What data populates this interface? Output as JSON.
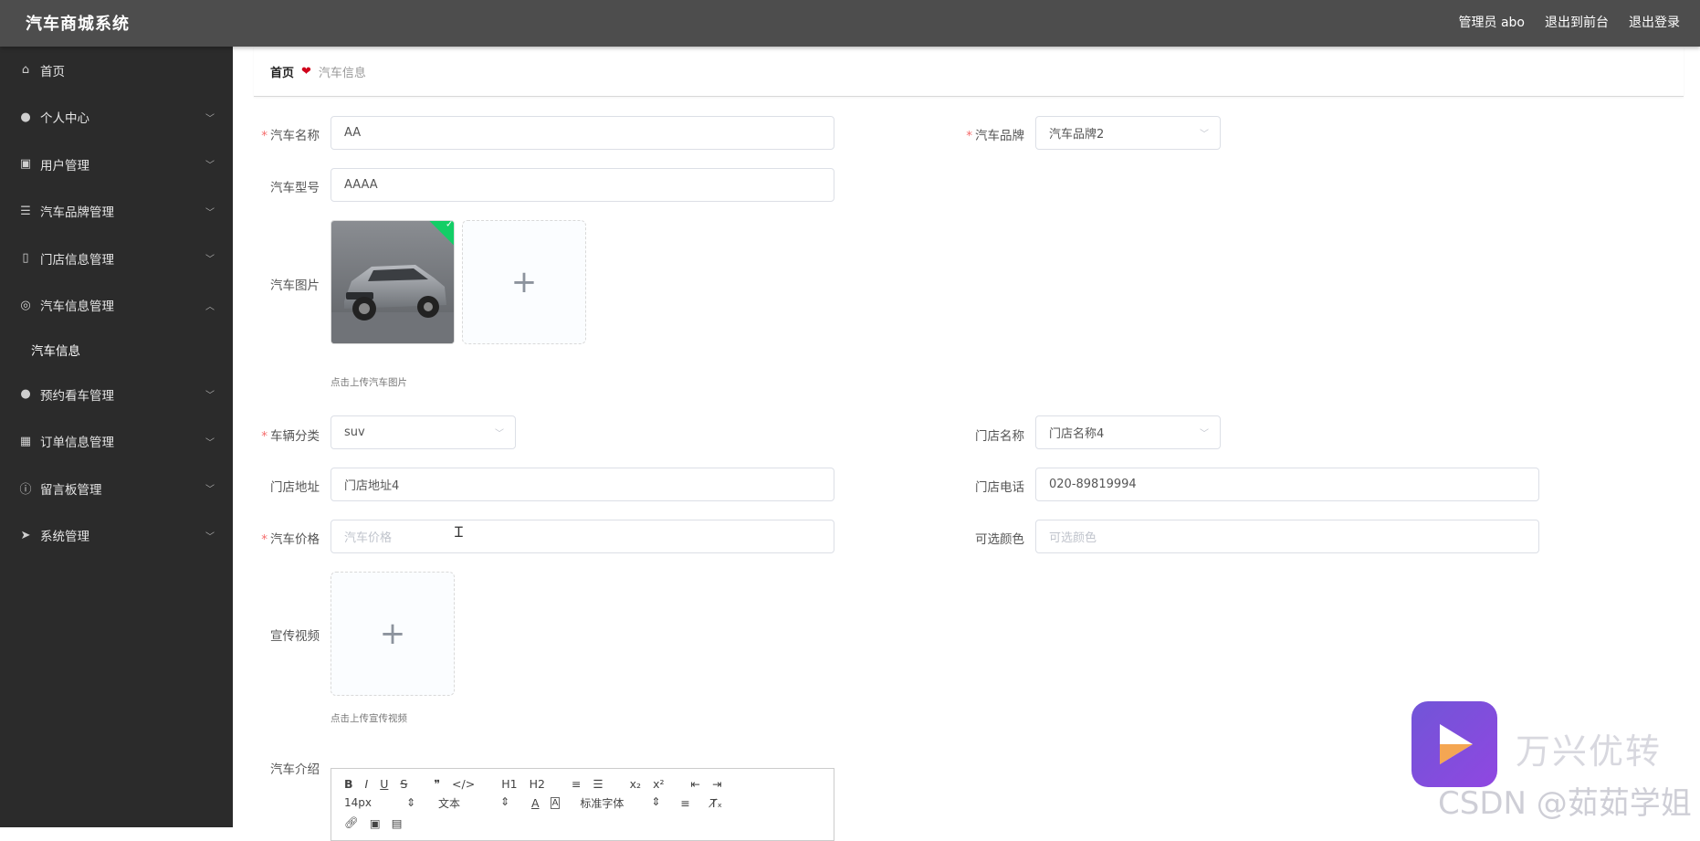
{
  "header": {
    "app_title": "汽车商城系统",
    "user": "管理员 abo",
    "to_front": "退出到前台",
    "logout": "退出登录"
  },
  "sidebar": {
    "items": [
      {
        "label": "首页",
        "icon": "home-icon"
      },
      {
        "label": "个人中心",
        "icon": "user-icon"
      },
      {
        "label": "用户管理",
        "icon": "clipboard-icon"
      },
      {
        "label": "汽车品牌管理",
        "icon": "sliders-icon"
      },
      {
        "label": "门店信息管理",
        "icon": "phone-icon"
      },
      {
        "label": "汽车信息管理",
        "icon": "target-icon",
        "expanded": true
      },
      {
        "label": "预约看车管理",
        "icon": "user-icon"
      },
      {
        "label": "订单信息管理",
        "icon": "grid-icon"
      },
      {
        "label": "留言板管理",
        "icon": "info-icon"
      },
      {
        "label": "系统管理",
        "icon": "send-icon"
      }
    ],
    "sub_item": "汽车信息"
  },
  "breadcrumb": {
    "home": "首页",
    "current": "汽车信息"
  },
  "form": {
    "car_name_label": "汽车名称",
    "car_name_value": "AA",
    "car_brand_label": "汽车品牌",
    "car_brand_value": "汽车品牌2",
    "car_model_label": "汽车型号",
    "car_model_value": "AAAA",
    "car_image_label": "汽车图片",
    "car_image_tip": "点击上传汽车图片",
    "category_label": "车辆分类",
    "category_value": "suv",
    "store_name_label": "门店名称",
    "store_name_value": "门店名称4",
    "store_addr_label": "门店地址",
    "store_addr_value": "门店地址4",
    "store_phone_label": "门店电话",
    "store_phone_value": "020-89819994",
    "price_label": "汽车价格",
    "price_placeholder": "汽车价格",
    "color_label": "可选颜色",
    "color_placeholder": "可选颜色",
    "video_label": "宣传视频",
    "video_tip": "点击上传宣传视频",
    "intro_label": "汽车介绍"
  },
  "editor": {
    "font_size": "14px",
    "block_type": "文本",
    "font_family": "标准字体",
    "tools_row1": [
      "B",
      "I",
      "U",
      "S",
      "❞",
      "</>",
      "H1",
      "H2",
      "≡",
      "☰",
      "x₂",
      "x²",
      "⇤",
      "⇥"
    ]
  },
  "watermark": {
    "brand": "万兴优转",
    "csdn": "CSDN @茹茹学姐"
  },
  "colors": {
    "topbar": "#4d4d4d",
    "sidebar": "#2b2b2b",
    "required": "#f56c6c",
    "heart": "#d0021b",
    "success": "#13ce66"
  }
}
